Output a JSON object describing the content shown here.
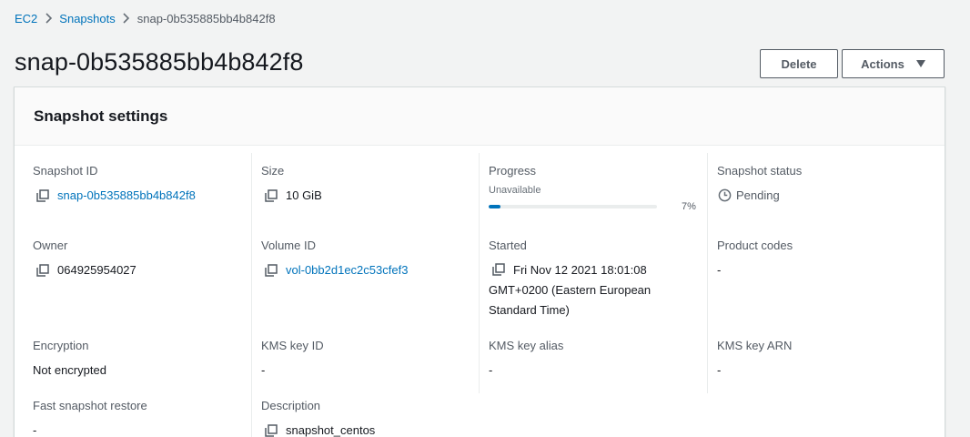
{
  "breadcrumb": {
    "items": [
      "EC2",
      "Snapshots"
    ],
    "current": "snap-0b535885bb4b842f8"
  },
  "header": {
    "title": "snap-0b535885bb4b842f8",
    "delete_label": "Delete",
    "actions_label": "Actions"
  },
  "panel": {
    "title": "Snapshot settings",
    "fields": {
      "snapshot_id": {
        "label": "Snapshot ID",
        "value": "snap-0b535885bb4b842f8"
      },
      "size": {
        "label": "Size",
        "value": "10 GiB"
      },
      "progress": {
        "label": "Progress",
        "sub": "Unavailable",
        "percent": 7,
        "percent_label": "7%"
      },
      "status": {
        "label": "Snapshot status",
        "value": "Pending"
      },
      "owner": {
        "label": "Owner",
        "value": "064925954027"
      },
      "volume_id": {
        "label": "Volume ID",
        "value": "vol-0bb2d1ec2c53cfef3"
      },
      "started": {
        "label": "Started",
        "value": "Fri Nov 12 2021 18:01:08 GMT+0200 (Eastern European Standard Time)"
      },
      "product_codes": {
        "label": "Product codes",
        "value": "-"
      },
      "encryption": {
        "label": "Encryption",
        "value": "Not encrypted"
      },
      "kms_key_id": {
        "label": "KMS key ID",
        "value": "-"
      },
      "kms_key_alias": {
        "label": "KMS key alias",
        "value": "-"
      },
      "kms_key_arn": {
        "label": "KMS key ARN",
        "value": "-"
      },
      "fast_restore": {
        "label": "Fast snapshot restore",
        "value": "-"
      },
      "description": {
        "label": "Description",
        "value": "snapshot_centos"
      }
    }
  },
  "colors": {
    "link": "#0073bb",
    "progress_fill": "#0073bb",
    "text": "#16191f",
    "label": "#545b64"
  }
}
